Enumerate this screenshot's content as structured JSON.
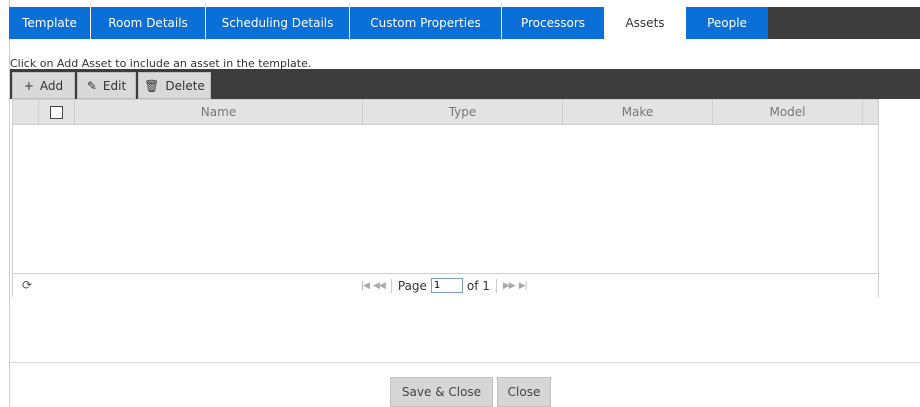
{
  "tabs": [
    {
      "label": "Template"
    },
    {
      "label": "Room Details"
    },
    {
      "label": "Scheduling Details"
    },
    {
      "label": "Custom Properties"
    },
    {
      "label": "Processors"
    },
    {
      "label": "Assets",
      "active": true
    },
    {
      "label": "People"
    }
  ],
  "instructions": "Click on Add Asset to include an asset in the template.",
  "toolbar": {
    "add_label": "Add",
    "edit_label": "Edit",
    "delete_label": "Delete",
    "add_icon": "plus-icon",
    "edit_icon": "pencil-icon",
    "delete_icon": "trash-icon"
  },
  "grid": {
    "columns": [
      "Name",
      "Type",
      "Make",
      "Model"
    ],
    "rows": []
  },
  "pager": {
    "page_label": "Page",
    "page_value": "1",
    "of_label": "of 1"
  },
  "footer": {
    "save_close_label": "Save & Close",
    "close_label": "Close"
  },
  "colors": {
    "tab_blue": "#0a6fd6",
    "dark_bar": "#3d3d3d"
  }
}
